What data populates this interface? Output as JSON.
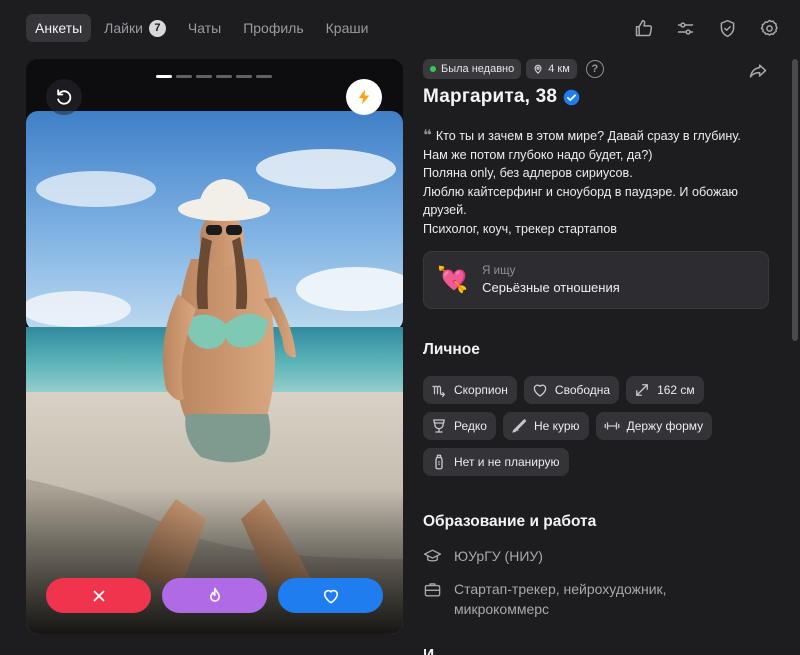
{
  "nav": {
    "tabs": [
      {
        "label": "Анкеты",
        "active": true
      },
      {
        "label": "Лайки",
        "badge": "7"
      },
      {
        "label": "Чаты"
      },
      {
        "label": "Профиль"
      },
      {
        "label": "Краши"
      }
    ],
    "icons": [
      "thumbs-up-icon",
      "filters-icon",
      "shield-check-icon",
      "gear-icon"
    ]
  },
  "photo": {
    "progress": {
      "total": 6,
      "current": 1
    },
    "actions": [
      "undo-icon",
      "lightning-icon",
      "dislike-x-icon",
      "superlike-flame-icon",
      "like-heart-icon"
    ]
  },
  "profile": {
    "status": "Была недавно",
    "distance": "4 км",
    "help": "?",
    "name": "Маргарита, 38",
    "verified": true,
    "bio": [
      "Кто ты и зачем в этом мире? Давай сразу в глубину.",
      "Нам же потом глубоко надо будет, да?)",
      "Поляна only, без адлеров сириусов.",
      "Люблю кайтсерфинг и сноуборд в паудэре. И обожаю",
      "друзей.",
      "Психолог, коуч, трекер стартапов"
    ],
    "seeking": {
      "label": "Я ищу",
      "value": "Серьёзные отношения"
    }
  },
  "personal": {
    "title": "Личное",
    "chips": [
      {
        "icon": "scorpio-icon",
        "label": "Скорпион"
      },
      {
        "icon": "heart-outline-icon",
        "label": "Свободна"
      },
      {
        "icon": "height-arrows-icon",
        "label": "162 см"
      },
      {
        "icon": "wine-glass-icon",
        "label": "Редко"
      },
      {
        "icon": "no-smoking-icon",
        "label": "Не курю"
      },
      {
        "icon": "dumbbell-icon",
        "label": "Держу форму"
      },
      {
        "icon": "baby-bottle-icon",
        "label": "Нет и не планирую"
      }
    ]
  },
  "education": {
    "title": "Образование и работа",
    "university": "ЮУрГУ (НИУ)",
    "job": "Стартап-трекер, нейрохудожник, микрокоммерс"
  },
  "colors": {
    "background": "#1d1d1f",
    "dislike": "#f0344e",
    "superlike": "#b06ae6",
    "like": "#1f7df0",
    "verified": "#1f7df0",
    "online": "#35c759"
  }
}
